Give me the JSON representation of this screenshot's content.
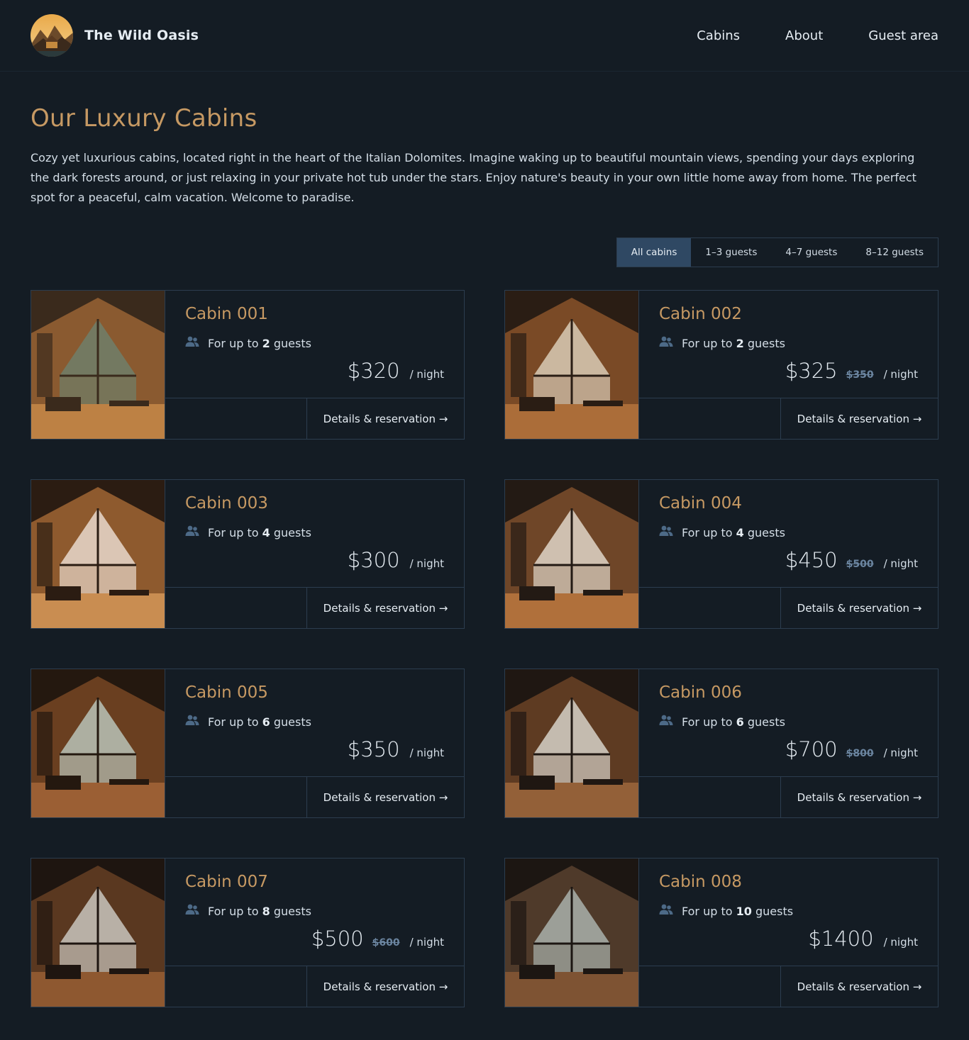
{
  "header": {
    "brand_name": "The Wild Oasis",
    "nav": [
      {
        "label": "Cabins"
      },
      {
        "label": "About"
      },
      {
        "label": "Guest area"
      }
    ]
  },
  "page": {
    "title": "Our Luxury Cabins",
    "intro": "Cozy yet luxurious cabins, located right in the heart of the Italian Dolomites. Imagine waking up to beautiful mountain views, spending your days exploring the dark forests around, or just relaxing in your private hot tub under the stars. Enjoy nature's beauty in your own little home away from home. The perfect spot for a peaceful, calm vacation. Welcome to paradise."
  },
  "filter": {
    "options": [
      {
        "label": "All cabins",
        "active": true
      },
      {
        "label": "1–3 guests",
        "active": false
      },
      {
        "label": "4–7 guests",
        "active": false
      },
      {
        "label": "8–12 guests",
        "active": false
      }
    ]
  },
  "colors": {
    "background": "#141c24",
    "accent": "#c69963",
    "border": "#2c3d4f",
    "active_filter": "#2f4863"
  },
  "cabins": [
    {
      "name": "Cabin 001",
      "guests_prefix": "For up to",
      "guests": "2",
      "guests_suffix": "guests",
      "price": "$320",
      "old_price": "",
      "per": "/ night",
      "link": "Details & reservation →"
    },
    {
      "name": "Cabin 002",
      "guests_prefix": "For up to",
      "guests": "2",
      "guests_suffix": "guests",
      "price": "$325",
      "old_price": "$350",
      "per": "/ night",
      "link": "Details & reservation →"
    },
    {
      "name": "Cabin 003",
      "guests_prefix": "For up to",
      "guests": "4",
      "guests_suffix": "guests",
      "price": "$300",
      "old_price": "",
      "per": "/ night",
      "link": "Details & reservation →"
    },
    {
      "name": "Cabin 004",
      "guests_prefix": "For up to",
      "guests": "4",
      "guests_suffix": "guests",
      "price": "$450",
      "old_price": "$500",
      "per": "/ night",
      "link": "Details & reservation →"
    },
    {
      "name": "Cabin 005",
      "guests_prefix": "For up to",
      "guests": "6",
      "guests_suffix": "guests",
      "price": "$350",
      "old_price": "",
      "per": "/ night",
      "link": "Details & reservation →"
    },
    {
      "name": "Cabin 006",
      "guests_prefix": "For up to",
      "guests": "6",
      "guests_suffix": "guests",
      "price": "$700",
      "old_price": "$800",
      "per": "/ night",
      "link": "Details & reservation →"
    },
    {
      "name": "Cabin 007",
      "guests_prefix": "For up to",
      "guests": "8",
      "guests_suffix": "guests",
      "price": "$500",
      "old_price": "$600",
      "per": "/ night",
      "link": "Details & reservation →"
    },
    {
      "name": "Cabin 008",
      "guests_prefix": "For up to",
      "guests": "10",
      "guests_suffix": "guests",
      "price": "$1400",
      "old_price": "",
      "per": "/ night",
      "link": "Details & reservation →"
    }
  ]
}
